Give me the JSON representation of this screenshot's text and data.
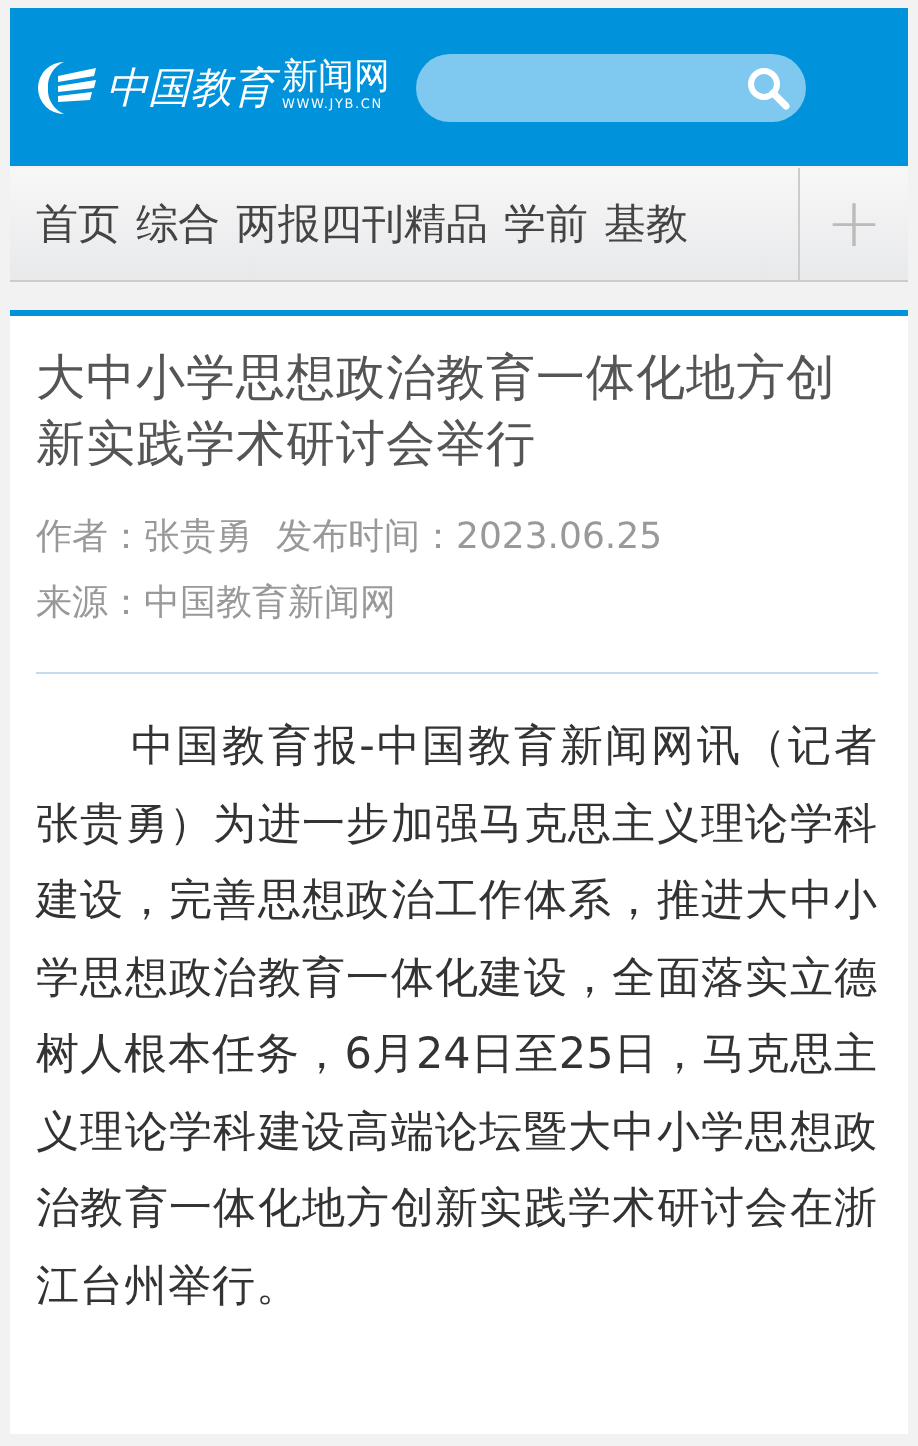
{
  "header": {
    "logo_title": "中国教育",
    "logo_subtitle": "新闻网",
    "logo_url": "WWW.JYB.CN"
  },
  "nav": {
    "items": [
      {
        "label": "首页",
        "selected": false
      },
      {
        "label": "综合",
        "selected": false
      },
      {
        "label": "两报四刊精品",
        "selected": false
      },
      {
        "label": "学前",
        "selected": false
      },
      {
        "label": "基教",
        "selected": false
      }
    ],
    "more_button": "+"
  },
  "article": {
    "title": "大中小学思想政治教育一体化地方创新实践学术研讨会举行",
    "author": "作者：张贵勇",
    "published": "发布时间：2023.06.25",
    "source": "来源：中国教育新闻网",
    "paragraphs": [
      "中国教育报-中国教育新闻网讯（记者张贵勇）为进一步加强马克思主义理论学科建设，完善思想政治工作体系，推进大中小学思想政治教育一体化建设，全面落实立德树人根本任务，6月24日至25日，马克思主义理论学科建设高端论坛暨大中小学思想政治教育一体化地方创新实践学术研讨会在浙江台州举行。"
    ]
  }
}
